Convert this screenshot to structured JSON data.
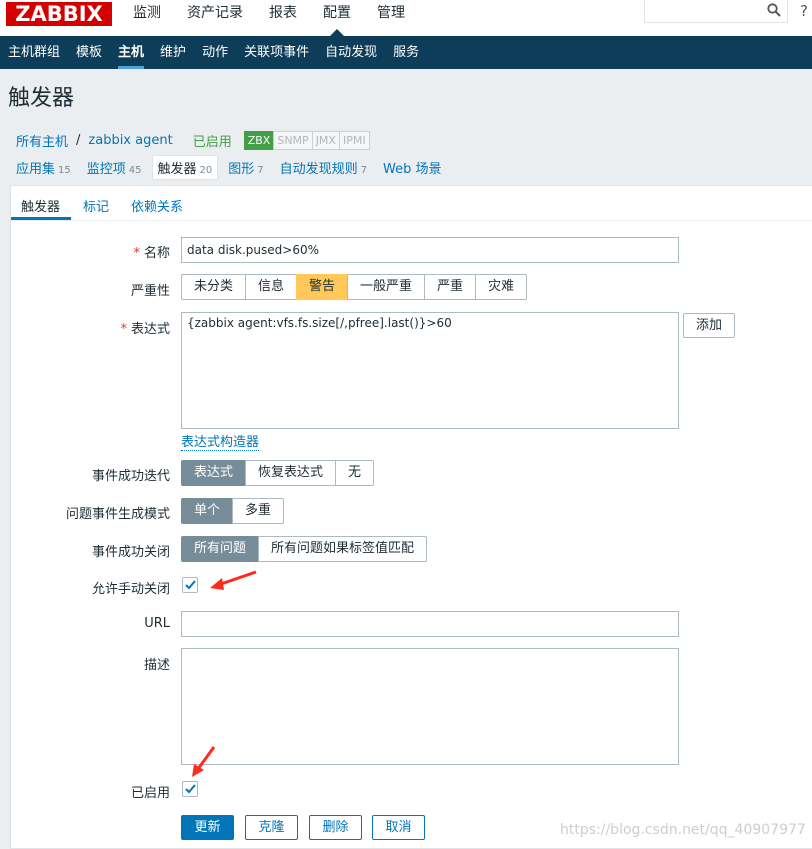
{
  "top_menu": {
    "logo": "ZABBIX",
    "items": [
      "监测",
      "资产记录",
      "报表",
      "配置",
      "管理"
    ],
    "active": "配置",
    "search_placeholder": "",
    "help_glyph": "?"
  },
  "sub_menu": {
    "items": [
      "主机群组",
      "模板",
      "主机",
      "维护",
      "动作",
      "关联项事件",
      "自动发现",
      "服务"
    ],
    "active": "主机"
  },
  "page_title": "触发器",
  "host_bar": {
    "all_hosts": "所有主机",
    "separator": "/",
    "host_name": "zabbix agent",
    "status": "已启用",
    "availability": [
      "ZBX",
      "SNMP",
      "JMX",
      "IPMI"
    ]
  },
  "item_tabs": [
    {
      "label": "应用集",
      "count": "15"
    },
    {
      "label": "监控项",
      "count": "45"
    },
    {
      "label": "触发器",
      "count": "20"
    },
    {
      "label": "图形",
      "count": "7"
    },
    {
      "label": "自动发现规则",
      "count": "7"
    },
    {
      "label": "Web 场景",
      "count": ""
    }
  ],
  "form_tabs": [
    "触发器",
    "标记",
    "依赖关系"
  ],
  "form": {
    "name_label": "名称",
    "name_value": "data disk.pused>60%",
    "severity_label": "严重性",
    "severity_options": [
      "未分类",
      "信息",
      "警告",
      "一般严重",
      "严重",
      "灾难"
    ],
    "severity_selected": "警告",
    "expression_label": "表达式",
    "expression_value": "{zabbix agent:vfs.fs.size[/,pfree].last()}>60",
    "add_button": "添加",
    "expression_builder_link": "表达式构造器",
    "ok_event_gen_label": "事件成功迭代",
    "ok_event_gen_options": [
      "表达式",
      "恢复表达式",
      "无"
    ],
    "ok_event_gen_selected": "表达式",
    "problem_mode_label": "问题事件生成模式",
    "problem_mode_options": [
      "单个",
      "多重"
    ],
    "problem_mode_selected": "单个",
    "ok_close_label": "事件成功关闭",
    "ok_close_options": [
      "所有问题",
      "所有问题如果标签值匹配"
    ],
    "ok_close_selected": "所有问题",
    "manual_close_label": "允许手动关闭",
    "manual_close_checked": true,
    "url_label": "URL",
    "url_value": "",
    "description_label": "描述",
    "description_value": "",
    "enabled_label": "已启用",
    "enabled_checked": true
  },
  "buttons": {
    "update": "更新",
    "clone": "克隆",
    "delete": "删除",
    "cancel": "取消"
  },
  "watermark": "https://blog.csdn.net/qq_40907977",
  "colors": {
    "accent": "#0275b8",
    "nav_bg": "#0e3d59",
    "warning": "#ffc859",
    "selected_segment": "#768d99",
    "annotation_arrow": "#ff2a1a"
  }
}
